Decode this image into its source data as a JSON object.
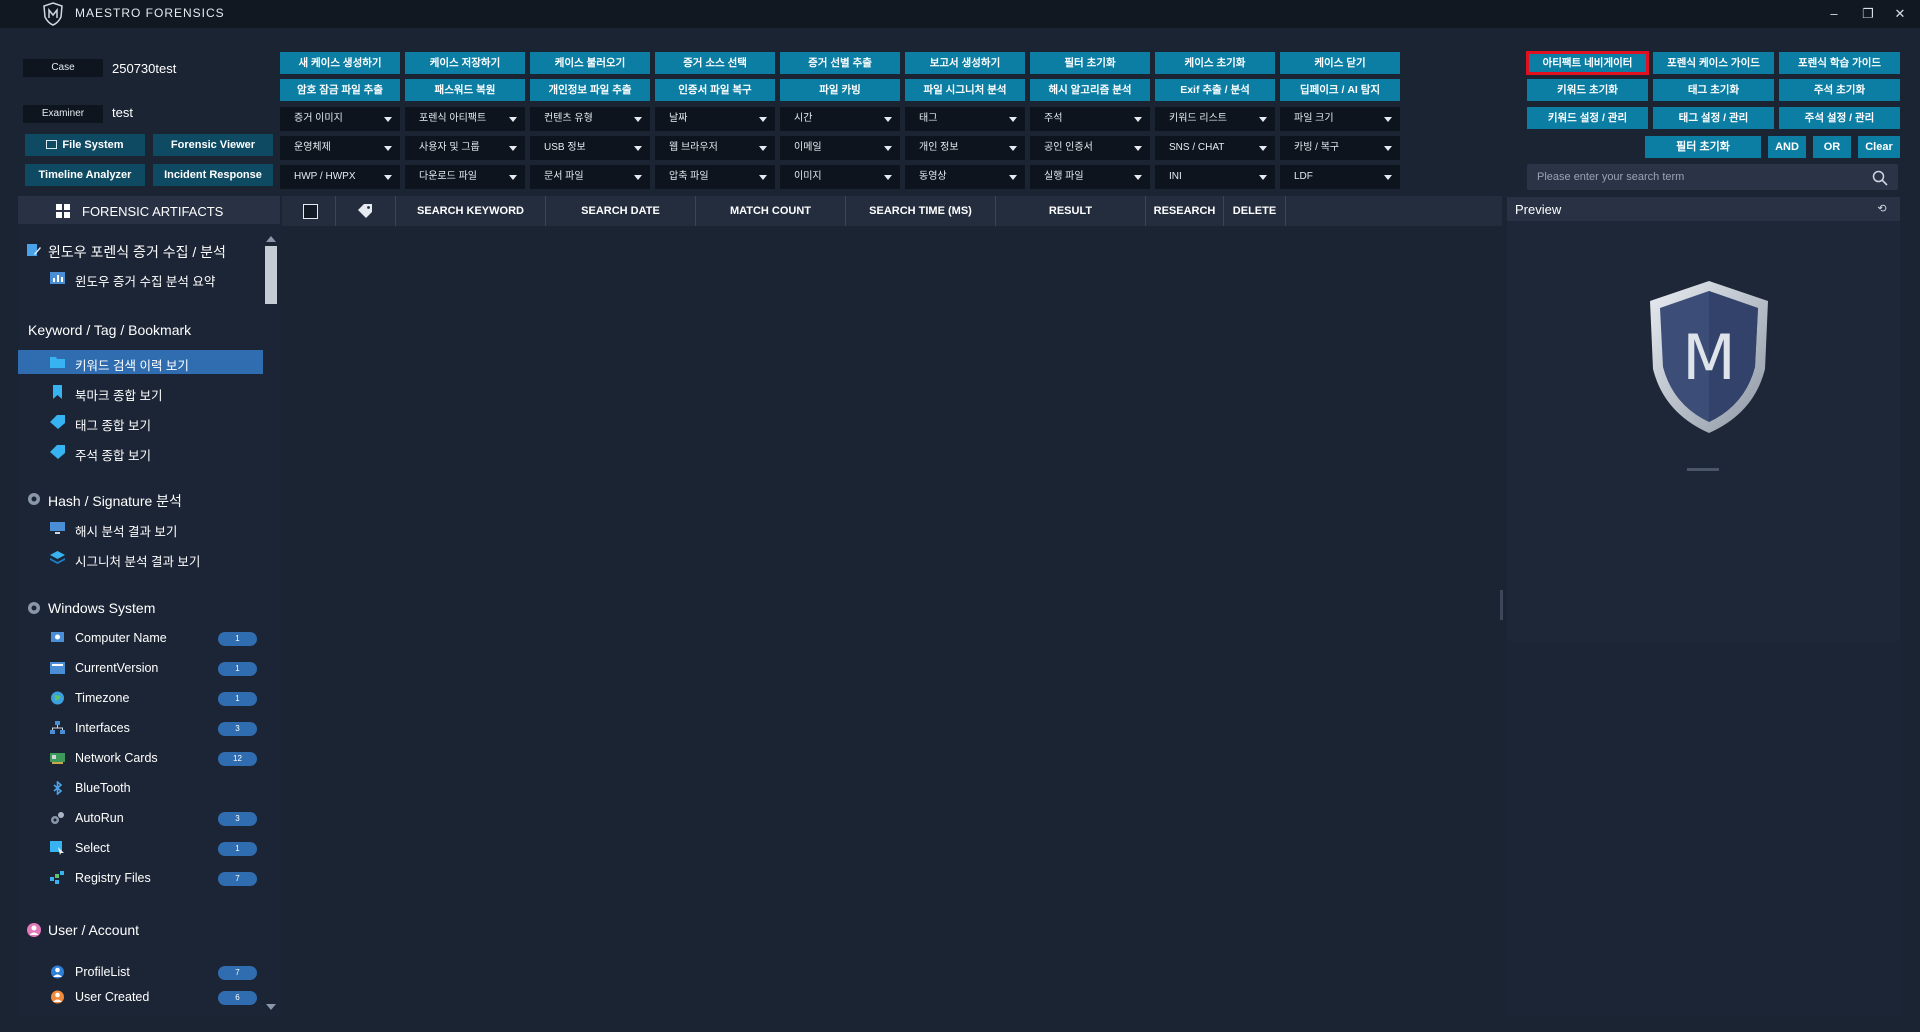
{
  "app": {
    "title": "MAESTRO FORENSICS"
  },
  "window_controls": {
    "minimize": "‒",
    "restore": "❐",
    "close": "✕"
  },
  "case": {
    "case_label": "Case",
    "case_value": "250730test",
    "examiner_label": "Examiner",
    "examiner_value": "test"
  },
  "nav_buttons": [
    "File System",
    "Forensic Viewer",
    "Timeline Analyzer",
    "Incident Response"
  ],
  "toolbar_row1": [
    "새 케이스 생성하기",
    "케이스 저장하기",
    "케이스 불러오기",
    "증거 소스 선택",
    "증거 선별 추출",
    "보고서 생성하기",
    "필터 초기화",
    "케이스 초기화",
    "케이스 닫기"
  ],
  "toolbar_row2": [
    "암호 잠금 파일 추출",
    "패스워드 복원",
    "개인정보 파일 추출",
    "인증서 파일 복구",
    "파일 카빙",
    "파일 시그니처 분석",
    "해시 알고리즘 분석",
    "Exif 추출 / 분석",
    "딥페이크 / AI 탐지"
  ],
  "dropdowns_row1": [
    "증거 이미지",
    "포렌식 아티팩트",
    "컨텐츠 유형",
    "날짜",
    "시간",
    "태그",
    "주석",
    "키워드 리스트",
    "파일 크기"
  ],
  "dropdowns_row2": [
    "운영체제",
    "사용자 및 그룹",
    "USB 정보",
    "웹 브라우저",
    "이메일",
    "개인 정보",
    "공인 인증서",
    "SNS / CHAT",
    "카빙 / 복구"
  ],
  "dropdowns_row3": [
    "HWP / HWPX",
    "다운로드 파일",
    "문서 파일",
    "압축 파일",
    "이미지",
    "동영상",
    "실행 파일",
    "INI",
    "LDF"
  ],
  "right_buttons": {
    "row1": [
      "아티팩트 네비게이터",
      "포렌식 케이스 가이드",
      "포렌식 학습 가이드"
    ],
    "row2": [
      "키워드 초기화",
      "태그 초기화",
      "주석 초기화"
    ],
    "row3": [
      "키워드 설정 / 관리",
      "태그 설정 / 관리",
      "주석 설정 / 관리"
    ],
    "filter_reset": "필터 초기화",
    "and": "AND",
    "or": "OR",
    "clear": "Clear"
  },
  "search": {
    "placeholder": "Please enter your search term"
  },
  "sidebar": {
    "header": "FORENSIC ARTIFACTS",
    "sections": [
      {
        "title": "윈도우 포렌식 증거 수집 / 분석",
        "items": [
          {
            "label": "윈도우 증거 수집 분석 요약"
          }
        ]
      },
      {
        "title": "Keyword / Tag / Bookmark",
        "items": [
          {
            "label": "키워드 검색 이력 보기",
            "active": true
          },
          {
            "label": "북마크 종합 보기"
          },
          {
            "label": "태그 종합 보기"
          },
          {
            "label": "주석 종합 보기"
          }
        ]
      },
      {
        "title": "Hash / Signature 분석",
        "items": [
          {
            "label": "해시 분석 결과 보기"
          },
          {
            "label": "시그니처 분석 결과 보기"
          }
        ]
      },
      {
        "title": "Windows System",
        "items": [
          {
            "label": "Computer Name",
            "count": "1"
          },
          {
            "label": "CurrentVersion",
            "count": "1"
          },
          {
            "label": "Timezone",
            "count": "1"
          },
          {
            "label": "Interfaces",
            "count": "3"
          },
          {
            "label": "Network Cards",
            "count": "12"
          },
          {
            "label": "BlueTooth"
          },
          {
            "label": "AutoRun",
            "count": "3"
          },
          {
            "label": "Select",
            "count": "1"
          },
          {
            "label": "Registry Files",
            "count": "7"
          }
        ]
      },
      {
        "title": "User / Account",
        "items": [
          {
            "label": "ProfileList",
            "count": "7"
          },
          {
            "label": "User Created",
            "count": "6"
          }
        ]
      }
    ]
  },
  "table": {
    "columns": [
      "SEARCH KEYWORD",
      "SEARCH DATE",
      "MATCH COUNT",
      "SEARCH TIME (MS)",
      "RESULT",
      "RESEARCH",
      "DELETE"
    ]
  },
  "preview": {
    "title": "Preview",
    "pin": "⟲",
    "logo_letter": "M"
  },
  "colors": {
    "accent": "#0c7ea4",
    "active_item": "#2f6db0",
    "highlight_outline": "#e01020",
    "background": "#1b2433"
  }
}
